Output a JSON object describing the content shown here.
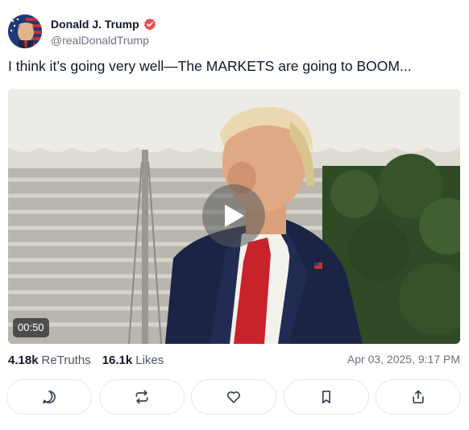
{
  "author": {
    "display_name": "Donald J. Trump",
    "handle": "@realDonaldTrump",
    "verified_icon": "verified-badge-icon",
    "avatar_icon": "flag-portrait-avatar"
  },
  "post": {
    "text": "I think it’s going very well—The MARKETS are going to BOOM..."
  },
  "media": {
    "type": "video",
    "duration": "00:50",
    "play_icon": "play-icon"
  },
  "stats": {
    "retruths_count": "4.18k",
    "retruths_label": "ReTruths",
    "likes_count": "16.1k",
    "likes_label": "Likes",
    "timestamp": "Apr 03, 2025, 9:17 PM"
  },
  "actions": [
    {
      "icon": "reply-icon"
    },
    {
      "icon": "retruth-icon"
    },
    {
      "icon": "like-icon"
    },
    {
      "icon": "bookmark-icon"
    },
    {
      "icon": "share-icon"
    }
  ],
  "colors": {
    "verified": "#e84d4d",
    "text_primary": "#111827",
    "text_secondary": "#6b7280",
    "border": "#e5e7eb"
  }
}
